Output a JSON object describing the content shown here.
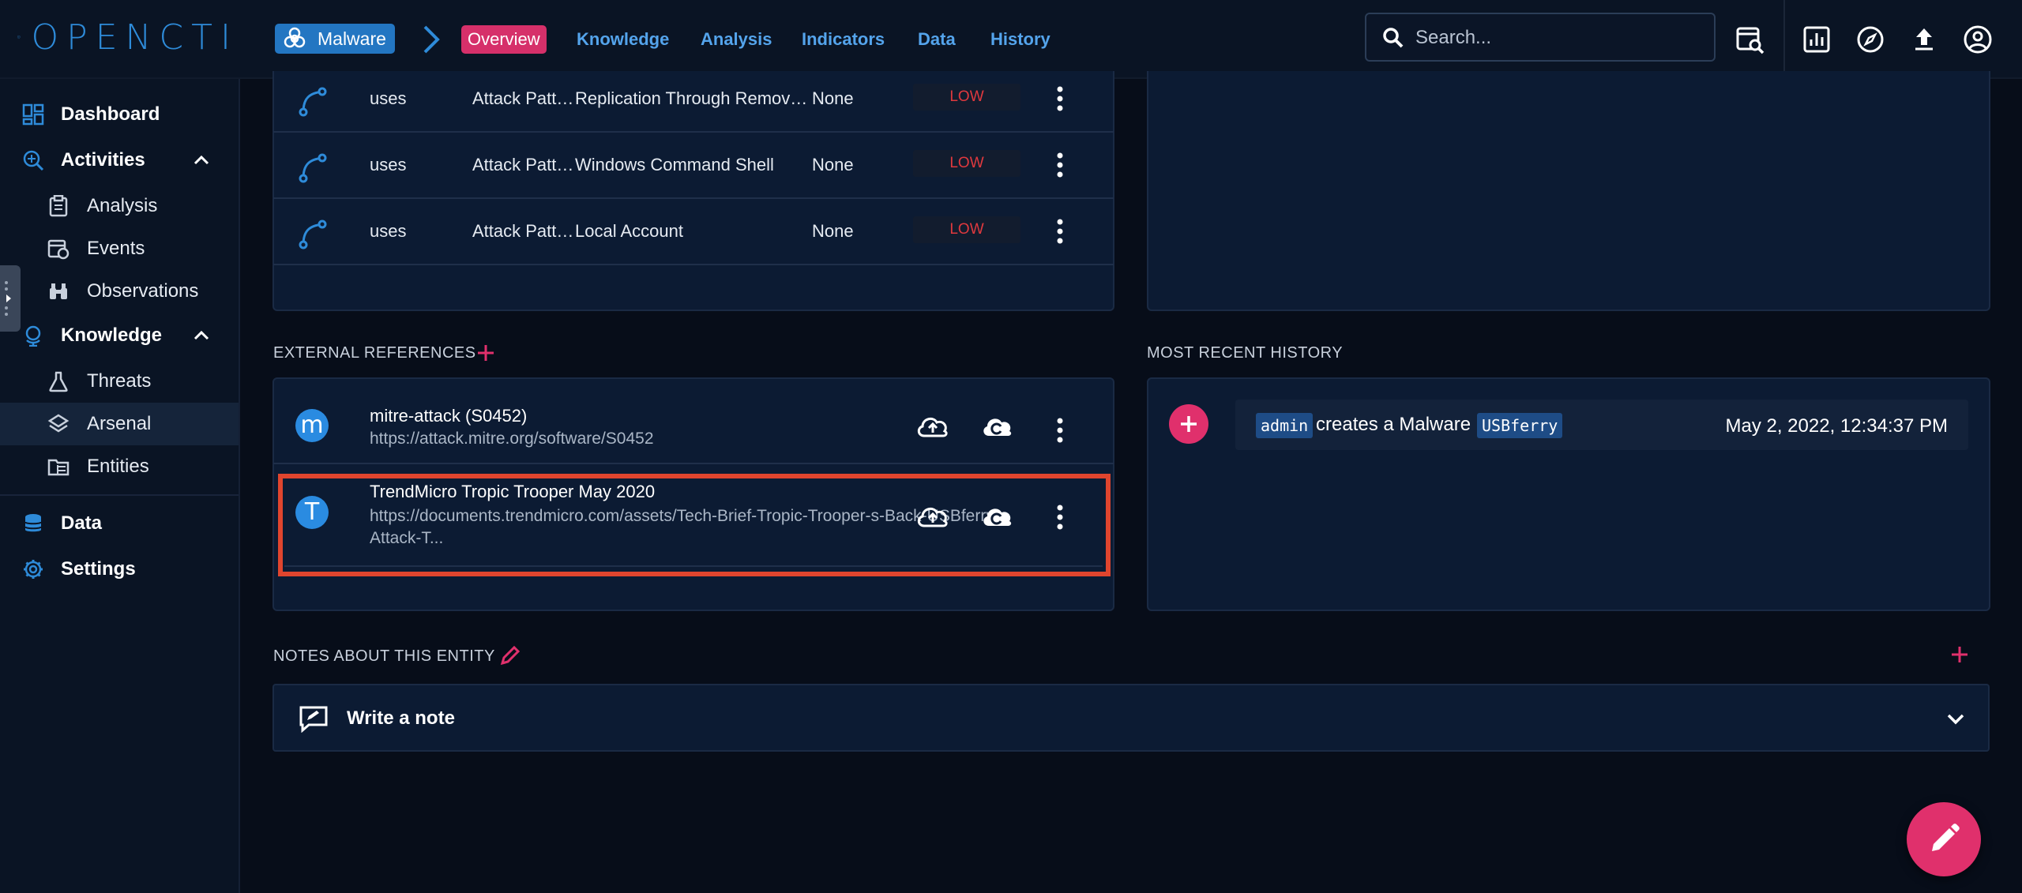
{
  "app": {
    "logo_text": "OPENCTI"
  },
  "breadcrumb": {
    "entity_type": "Malware"
  },
  "tabs": [
    {
      "label": "Overview",
      "active": true
    },
    {
      "label": "Knowledge"
    },
    {
      "label": "Analysis"
    },
    {
      "label": "Indicators"
    },
    {
      "label": "Data"
    },
    {
      "label": "History"
    }
  ],
  "search": {
    "placeholder": "Search..."
  },
  "toolbar_icons": [
    "investigation-search-icon",
    "dashboard-chart-icon",
    "explore-compass-icon",
    "upload-icon",
    "account-circle-icon"
  ],
  "sidebar": {
    "items": [
      {
        "label": "Dashboard",
        "icon": "dashboard-icon"
      },
      {
        "label": "Activities",
        "icon": "activities-icon",
        "expanded": true
      },
      {
        "label": "Analysis",
        "icon": "clipboard-icon"
      },
      {
        "label": "Events",
        "icon": "events-icon"
      },
      {
        "label": "Observations",
        "icon": "binoculars-icon"
      },
      {
        "label": "Knowledge",
        "icon": "globe-icon",
        "expanded": true
      },
      {
        "label": "Threats",
        "icon": "flask-icon"
      },
      {
        "label": "Arsenal",
        "icon": "layers-icon",
        "selected": true
      },
      {
        "label": "Entities",
        "icon": "folder-table-icon"
      },
      {
        "label": "Data",
        "icon": "database-icon"
      },
      {
        "label": "Settings",
        "icon": "settings-icon"
      }
    ]
  },
  "relations": {
    "rows": [
      {
        "relation": "uses",
        "type": "Attack Pattern",
        "name": "Replication Through Removable Media",
        "value": "None",
        "badge": "LOW"
      },
      {
        "relation": "uses",
        "type": "Attack Pattern",
        "name": "Windows Command Shell",
        "value": "None",
        "badge": "LOW"
      },
      {
        "relation": "uses",
        "type": "Attack Pattern",
        "name": "Local Account",
        "value": "None",
        "badge": "LOW"
      }
    ]
  },
  "external_references": {
    "title": "EXTERNAL REFERENCES",
    "items": [
      {
        "avatar": "m",
        "title": "mitre-attack (S0452)",
        "url": "https://attack.mitre.org/software/S0452"
      },
      {
        "avatar": "T",
        "title": "TrendMicro Tropic Trooper May 2020",
        "url": "https://documents.trendmicro.com/assets/Tech-Brief-Tropic-Trooper-s-Back-USBferry-Attack-T..."
      }
    ]
  },
  "history": {
    "title": "MOST RECENT HISTORY",
    "entries": [
      {
        "user": "admin",
        "text": "creates a Malware",
        "entity": "USBferry",
        "date": "May 2, 2022, 12:34:37 PM"
      }
    ]
  },
  "notes": {
    "title": "NOTES ABOUT THIS ENTITY",
    "write_label": "Write a note"
  },
  "colors": {
    "accent": "#d6306a",
    "primary": "#2376c2",
    "background": "#070d19",
    "panel": "#0c1b33",
    "danger": "#e0393e"
  }
}
